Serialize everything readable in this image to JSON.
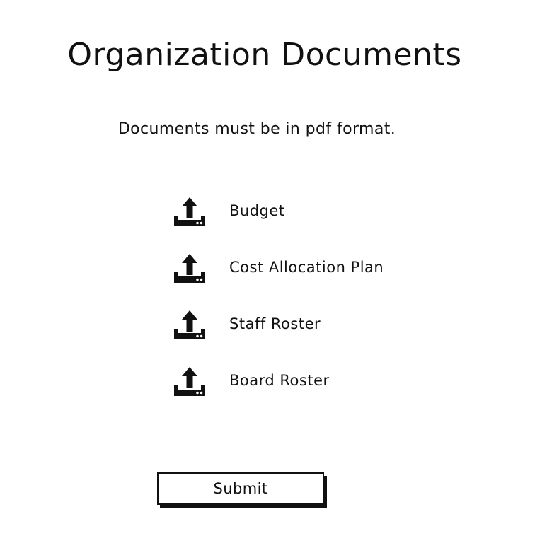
{
  "page": {
    "title": "Organization Documents",
    "instructions": "Documents must be in pdf format."
  },
  "documents": [
    {
      "label": "Budget",
      "icon": "upload-icon"
    },
    {
      "label": "Cost Allocation Plan",
      "icon": "upload-icon"
    },
    {
      "label": "Staff Roster",
      "icon": "upload-icon"
    },
    {
      "label": "Board Roster",
      "icon": "upload-icon"
    }
  ],
  "submit": {
    "label": "Submit"
  },
  "colors": {
    "ink": "#111111",
    "background": "#ffffff"
  }
}
